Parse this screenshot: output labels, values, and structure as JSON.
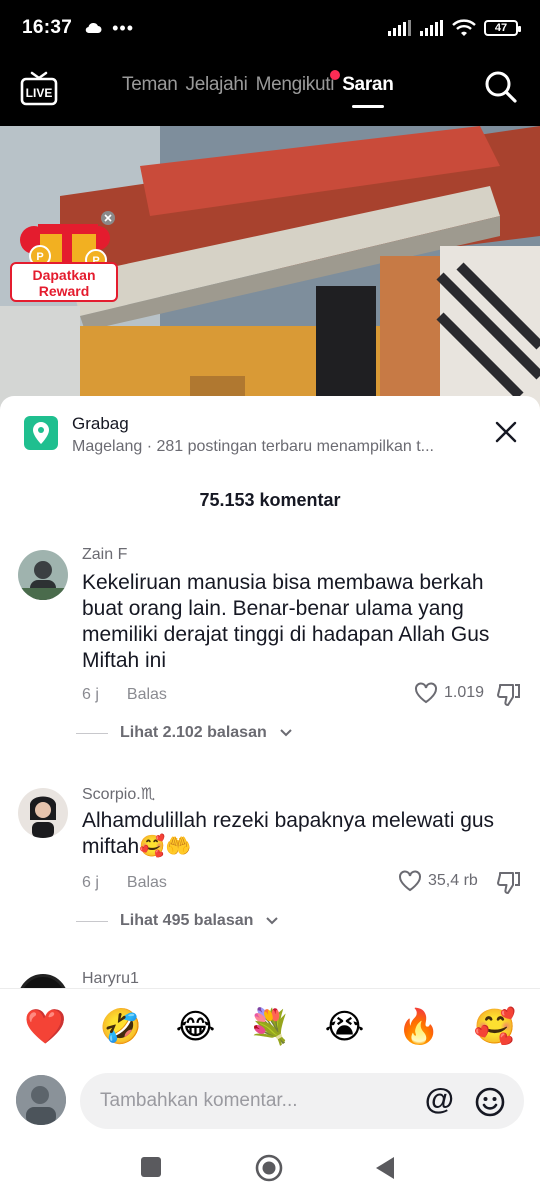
{
  "status_bar": {
    "time": "16:37",
    "battery": "47"
  },
  "nav": {
    "tabs": [
      {
        "label": "Teman"
      },
      {
        "label": "Jelajahi"
      },
      {
        "label": "Mengikuti",
        "has_dot": true
      },
      {
        "label": "Saran",
        "active": true
      }
    ],
    "live_label": "LIVE"
  },
  "reward": {
    "label_line1": "Dapatkan",
    "label_line2": "Reward"
  },
  "location": {
    "title": "Grabag",
    "subtitle": "Magelang · 281 postingan terbaru menampilkan t..."
  },
  "comments_count": "75.153 komentar",
  "comments": [
    {
      "user": "Zain F",
      "text": "Kekeliruan manusia bisa membawa berkah buat orang lain. Benar-benar ulama yang memiliki derajat tinggi di hadapan Allah Gus Miftah ini",
      "time": "6 j",
      "reply_label": "Balas",
      "likes": "1.019",
      "view_replies": "Lihat 2.102 balasan"
    },
    {
      "user": "Scorpio.♏",
      "text": "Alhamdulillah rezeki bapaknya melewati gus miftah🥰🤲",
      "time": "6 j",
      "reply_label": "Balas",
      "likes": "35,4 rb",
      "view_replies": "Lihat 495 balasan"
    },
    {
      "user": "Haryru1"
    }
  ],
  "emojis": [
    "❤️",
    "🤣",
    "😂",
    "💐",
    "😭",
    "🔥",
    "🥰"
  ],
  "input": {
    "placeholder": "Tambahkan komentar...",
    "at_symbol": "@"
  },
  "colors": {
    "accent": "#fe2c55",
    "location_badge": "#1fbf8f",
    "reward_red": "#e41c2e"
  }
}
